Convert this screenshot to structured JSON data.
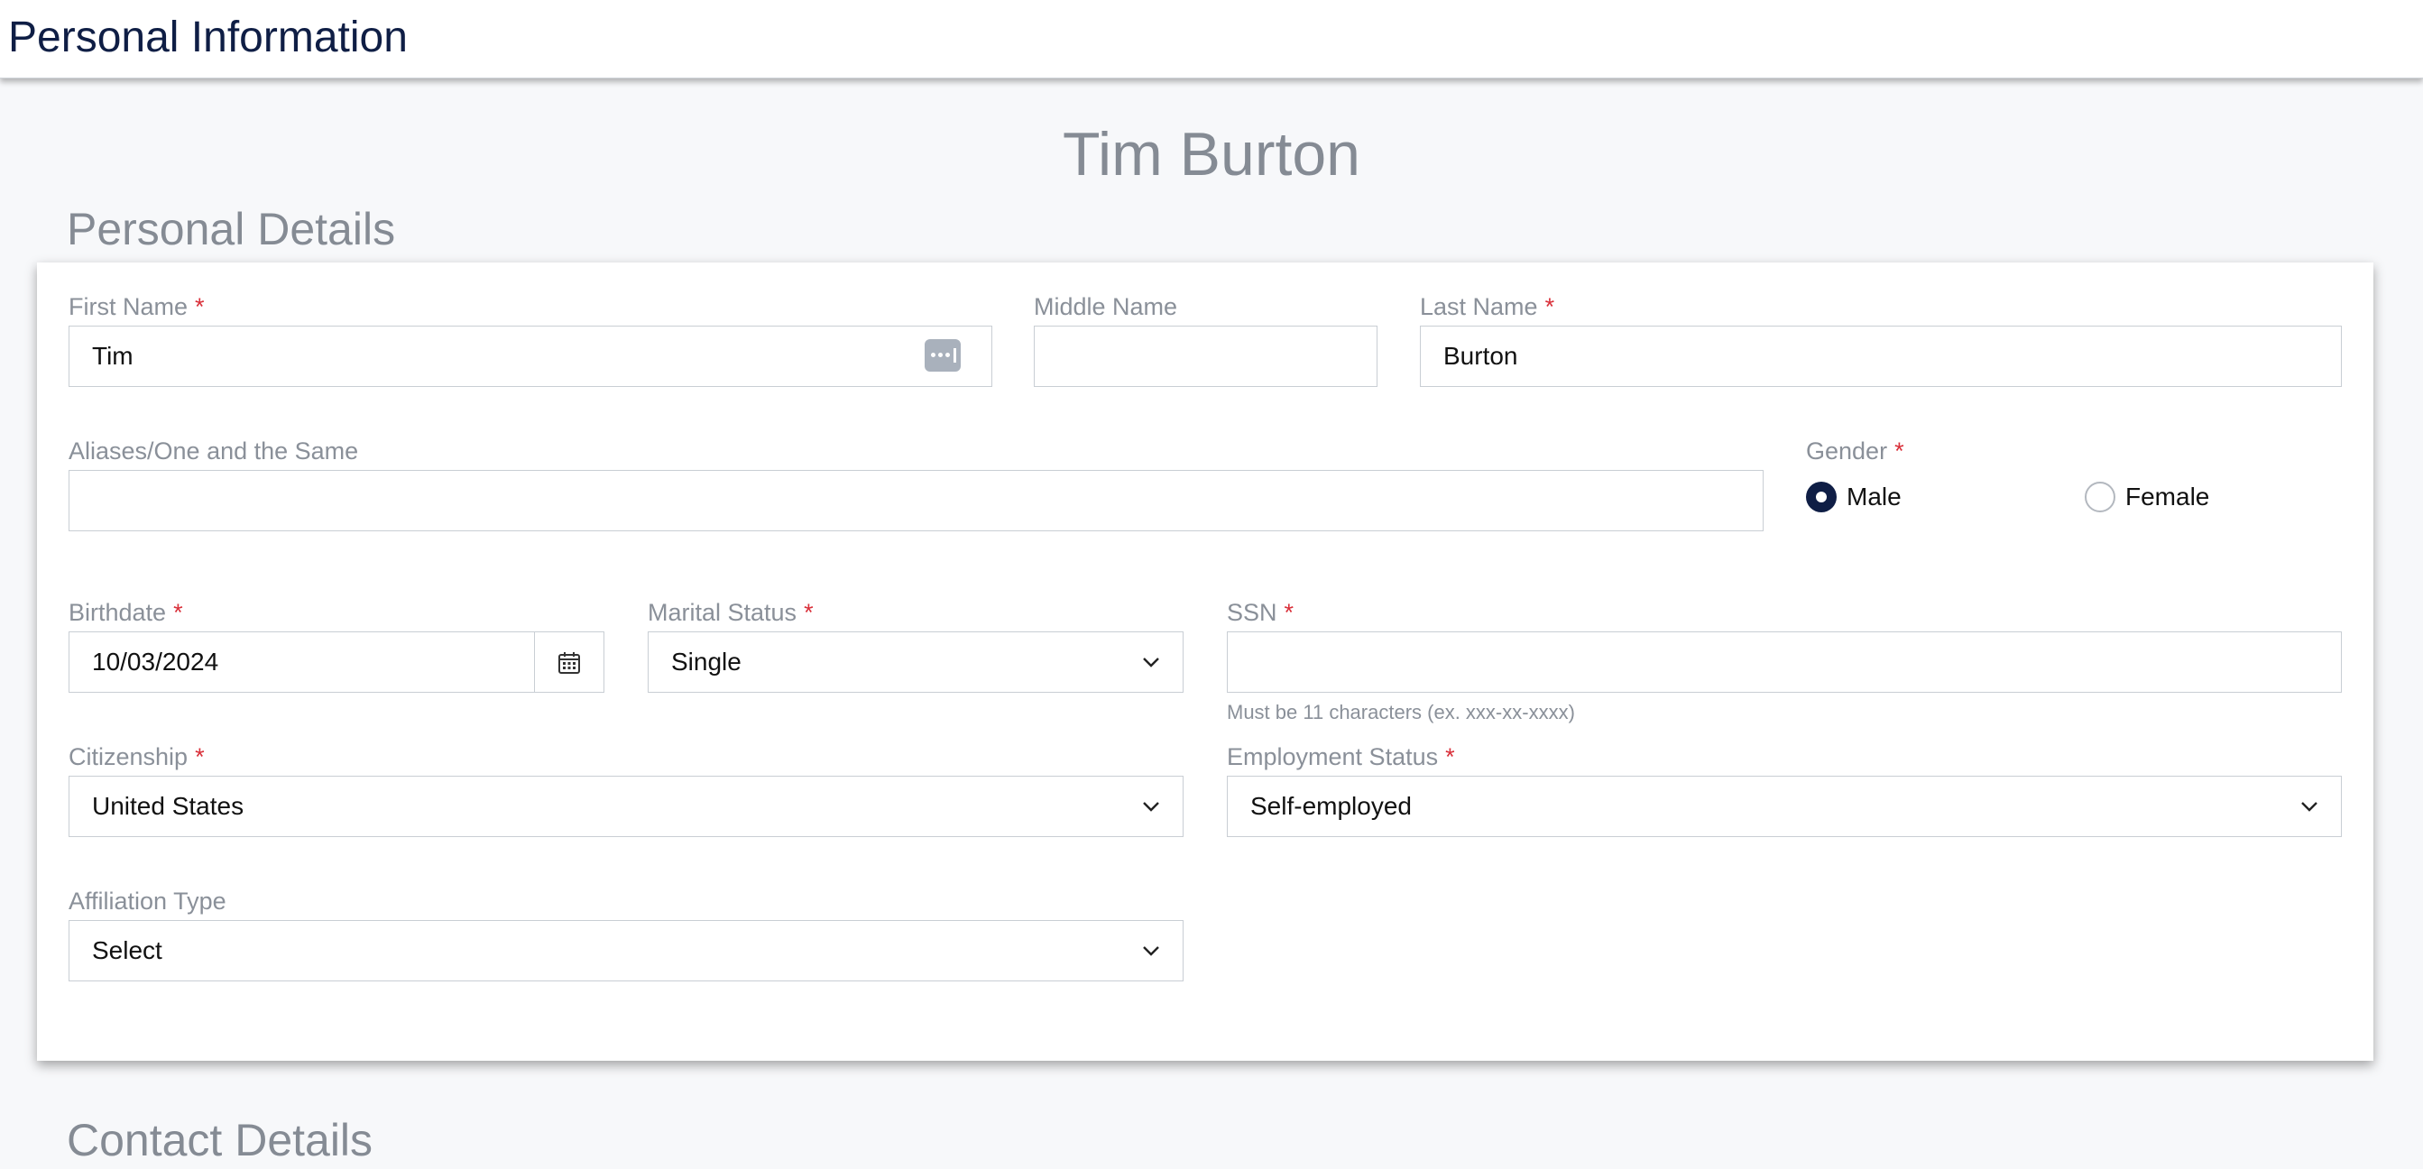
{
  "header": {
    "title": "Personal Information"
  },
  "person": {
    "name": "Tim Burton"
  },
  "section": {
    "title": "Personal Details"
  },
  "next_section": {
    "title": "Contact Details"
  },
  "form": {
    "first_name": {
      "label": "First Name",
      "required": "*",
      "value": "Tim"
    },
    "middle_name": {
      "label": "Middle Name",
      "value": ""
    },
    "last_name": {
      "label": "Last Name",
      "required": "*",
      "value": "Burton"
    },
    "aliases": {
      "label": "Aliases/One and the Same",
      "value": ""
    },
    "gender": {
      "label": "Gender",
      "required": "*",
      "options": [
        "Male",
        "Female"
      ],
      "selected": "Male"
    },
    "birthdate": {
      "label": "Birthdate",
      "required": "*",
      "value": "10/03/2024"
    },
    "marital_status": {
      "label": "Marital Status",
      "required": "*",
      "value": "Single"
    },
    "ssn": {
      "label": "SSN",
      "required": "*",
      "value": "",
      "hint": "Must be 11 characters (ex. xxx-xx-xxxx)"
    },
    "citizenship": {
      "label": "Citizenship",
      "required": "*",
      "value": "United States"
    },
    "employment_status": {
      "label": "Employment Status",
      "required": "*",
      "value": "Self-employed"
    },
    "affiliation_type": {
      "label": "Affiliation Type",
      "value": "Select"
    }
  },
  "icons": {
    "password_manager": "password-manager-icon",
    "calendar": "calendar-icon",
    "dropdown": "chevron-down-icon"
  },
  "colors": {
    "brand_navy": "#0f1e45",
    "required_red": "#d9303a",
    "label_gray": "#8a9099"
  }
}
